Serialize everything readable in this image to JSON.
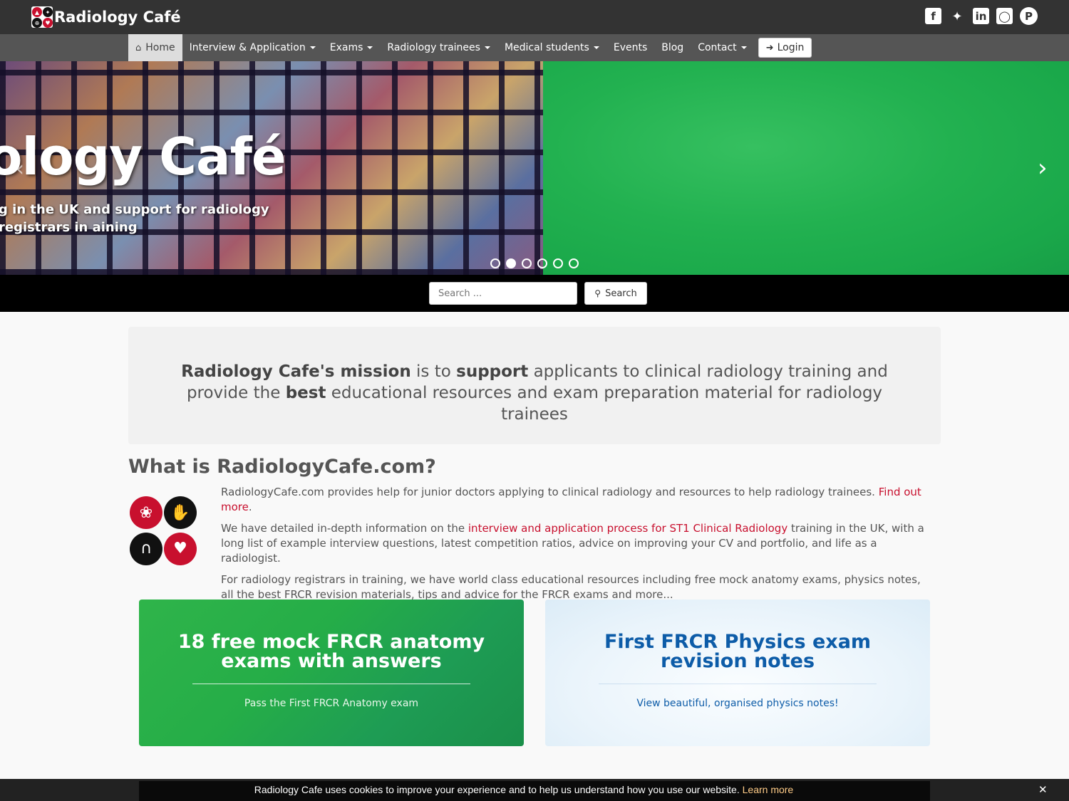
{
  "header": {
    "brand_name": "Radiology Café",
    "social_icons": [
      "facebook-icon",
      "twitter-icon",
      "linkedin-icon",
      "instagram-icon",
      "pinterest-icon"
    ]
  },
  "nav": {
    "items": [
      {
        "label": "Home",
        "active": true,
        "dropdown": false
      },
      {
        "label": "Interview & Application",
        "dropdown": true
      },
      {
        "label": "Exams",
        "dropdown": true
      },
      {
        "label": "Radiology trainees",
        "dropdown": true
      },
      {
        "label": "Medical students",
        "dropdown": true
      },
      {
        "label": "Events",
        "dropdown": false
      },
      {
        "label": "Blog",
        "dropdown": false
      },
      {
        "label": "Contact",
        "dropdown": true
      }
    ],
    "login_label": "Login"
  },
  "hero": {
    "title": "ology Café",
    "subtitle": "g in the UK and support for radiology registrars in aining",
    "active_slide": 2,
    "slide_count": 6
  },
  "search": {
    "placeholder": "Search ...",
    "button_label": "Search"
  },
  "mission": {
    "p1": "Radiology Cafe's mission",
    "p2": " is to ",
    "p3": "support",
    "p4": " applicants to clinical radiology training and provide the ",
    "p5": "best",
    "p6": " educational resources and exam preparation material for radiology trainees"
  },
  "what": {
    "title": "What is RadiologyCafe.com?",
    "para1": "RadiologyCafe.com provides help for junior doctors applying to clinical radiology and resources to help radiology trainees. ",
    "para1_link": "Find out more",
    "para1_end": ".",
    "para2_start": "We have detailed in-depth information on the ",
    "para2_link": "interview and application process for ST1 Clinical Radiology",
    "para2_end": " training in the UK, with a long list of example interview questions, latest competition ratios, advice on improving your CV and portfolio, and life as a radiologist.",
    "para3": "For radiology registrars in training, we have world class educational resources including free mock anatomy exams, physics notes, all the best FRCR revision materials, tips and advice for the FRCR exams and more..."
  },
  "cards": [
    {
      "title": "18 free mock FRCR anatomy exams with answers",
      "subtitle": "Pass the First FRCR Anatomy exam"
    },
    {
      "title": "First FRCR Physics exam revision notes",
      "subtitle": "View beautiful, organised physics notes!"
    }
  ],
  "cookie": {
    "text": "Radiology Cafe uses cookies to improve your experience and to help us understand how you use our website. ",
    "link": "Learn more",
    "close": "✕"
  },
  "colors": {
    "brand_red": "#c8102e",
    "topbar": "#333333",
    "navbar": "#555555",
    "card_green": "#25ad48",
    "card_blue_text": "#0d5ca8"
  }
}
